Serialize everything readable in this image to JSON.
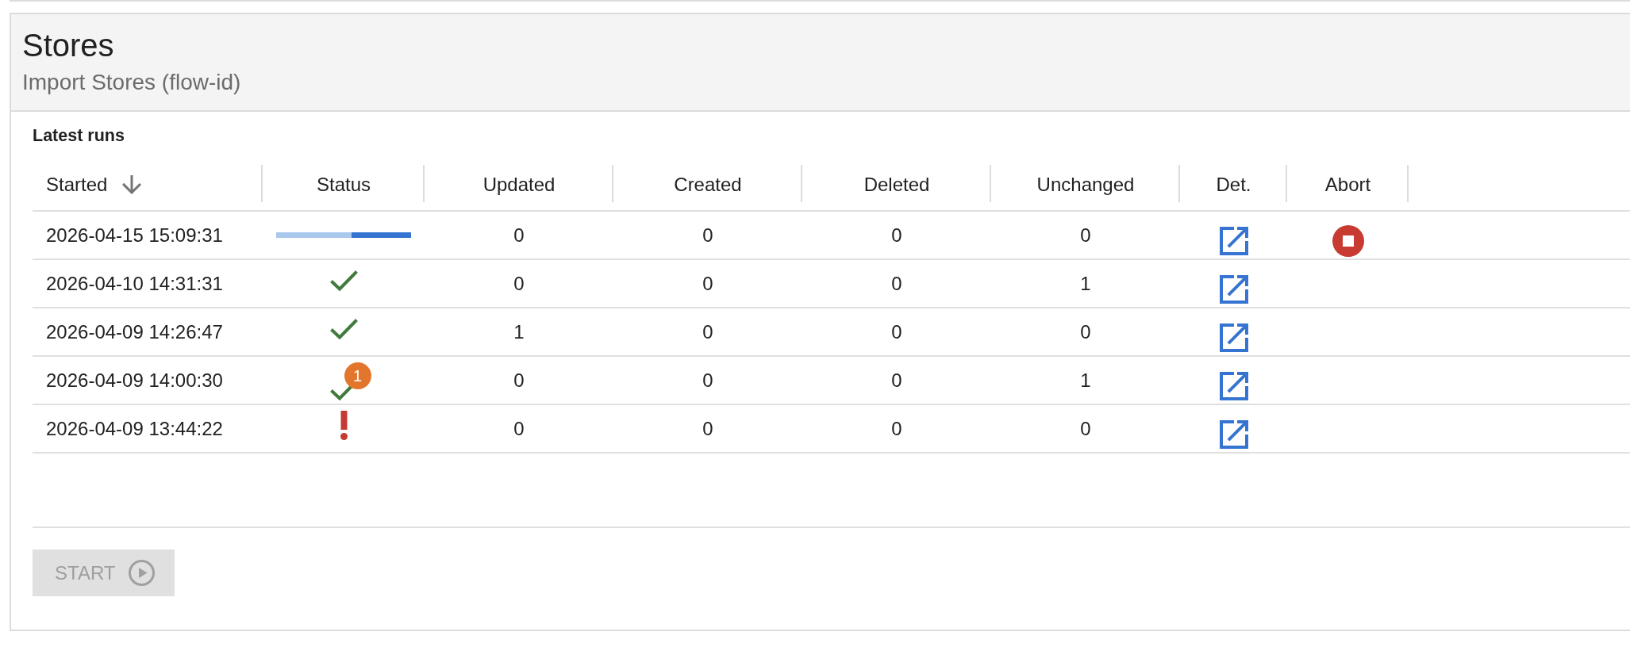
{
  "panel": {
    "title": "Stores",
    "subtitle": "Import Stores (flow-id)"
  },
  "runs": {
    "title": "Latest runs",
    "columns": [
      {
        "label": "Started",
        "sorted": true,
        "descending": true
      },
      {
        "label": "Status",
        "sorted": false
      },
      {
        "label": "Updated",
        "sorted": false
      },
      {
        "label": "Created",
        "sorted": false
      },
      {
        "label": "Deleted",
        "sorted": false
      },
      {
        "label": "Unchanged",
        "sorted": false
      },
      {
        "label": "Det.",
        "sorted": false
      },
      {
        "label": "Abort",
        "sorted": false
      }
    ],
    "rows": [
      {
        "started": "2026-04-15 15:09:31",
        "status": {
          "kind": "running",
          "level": 0.44
        },
        "updated": "0",
        "created": "0",
        "deleted": "0",
        "unchanged": "0",
        "abortable": true
      },
      {
        "started": "2026-04-10 14:31:31",
        "status": {
          "kind": "success"
        },
        "updated": "0",
        "created": "0",
        "deleted": "0",
        "unchanged": "1",
        "abortable": false
      },
      {
        "started": "2026-04-09 14:26:47",
        "status": {
          "kind": "success"
        },
        "updated": "1",
        "created": "0",
        "deleted": "0",
        "unchanged": "0",
        "abortable": false
      },
      {
        "started": "2026-04-09 14:00:30",
        "status": {
          "kind": "success",
          "badge": "1"
        },
        "updated": "0",
        "created": "0",
        "deleted": "0",
        "unchanged": "1",
        "abortable": false
      },
      {
        "started": "2026-04-09 13:44:22",
        "status": {
          "kind": "error"
        },
        "updated": "0",
        "created": "0",
        "deleted": "0",
        "unchanged": "0",
        "abortable": false
      }
    ]
  },
  "start_button": {
    "label": "START",
    "disabled": true
  }
}
